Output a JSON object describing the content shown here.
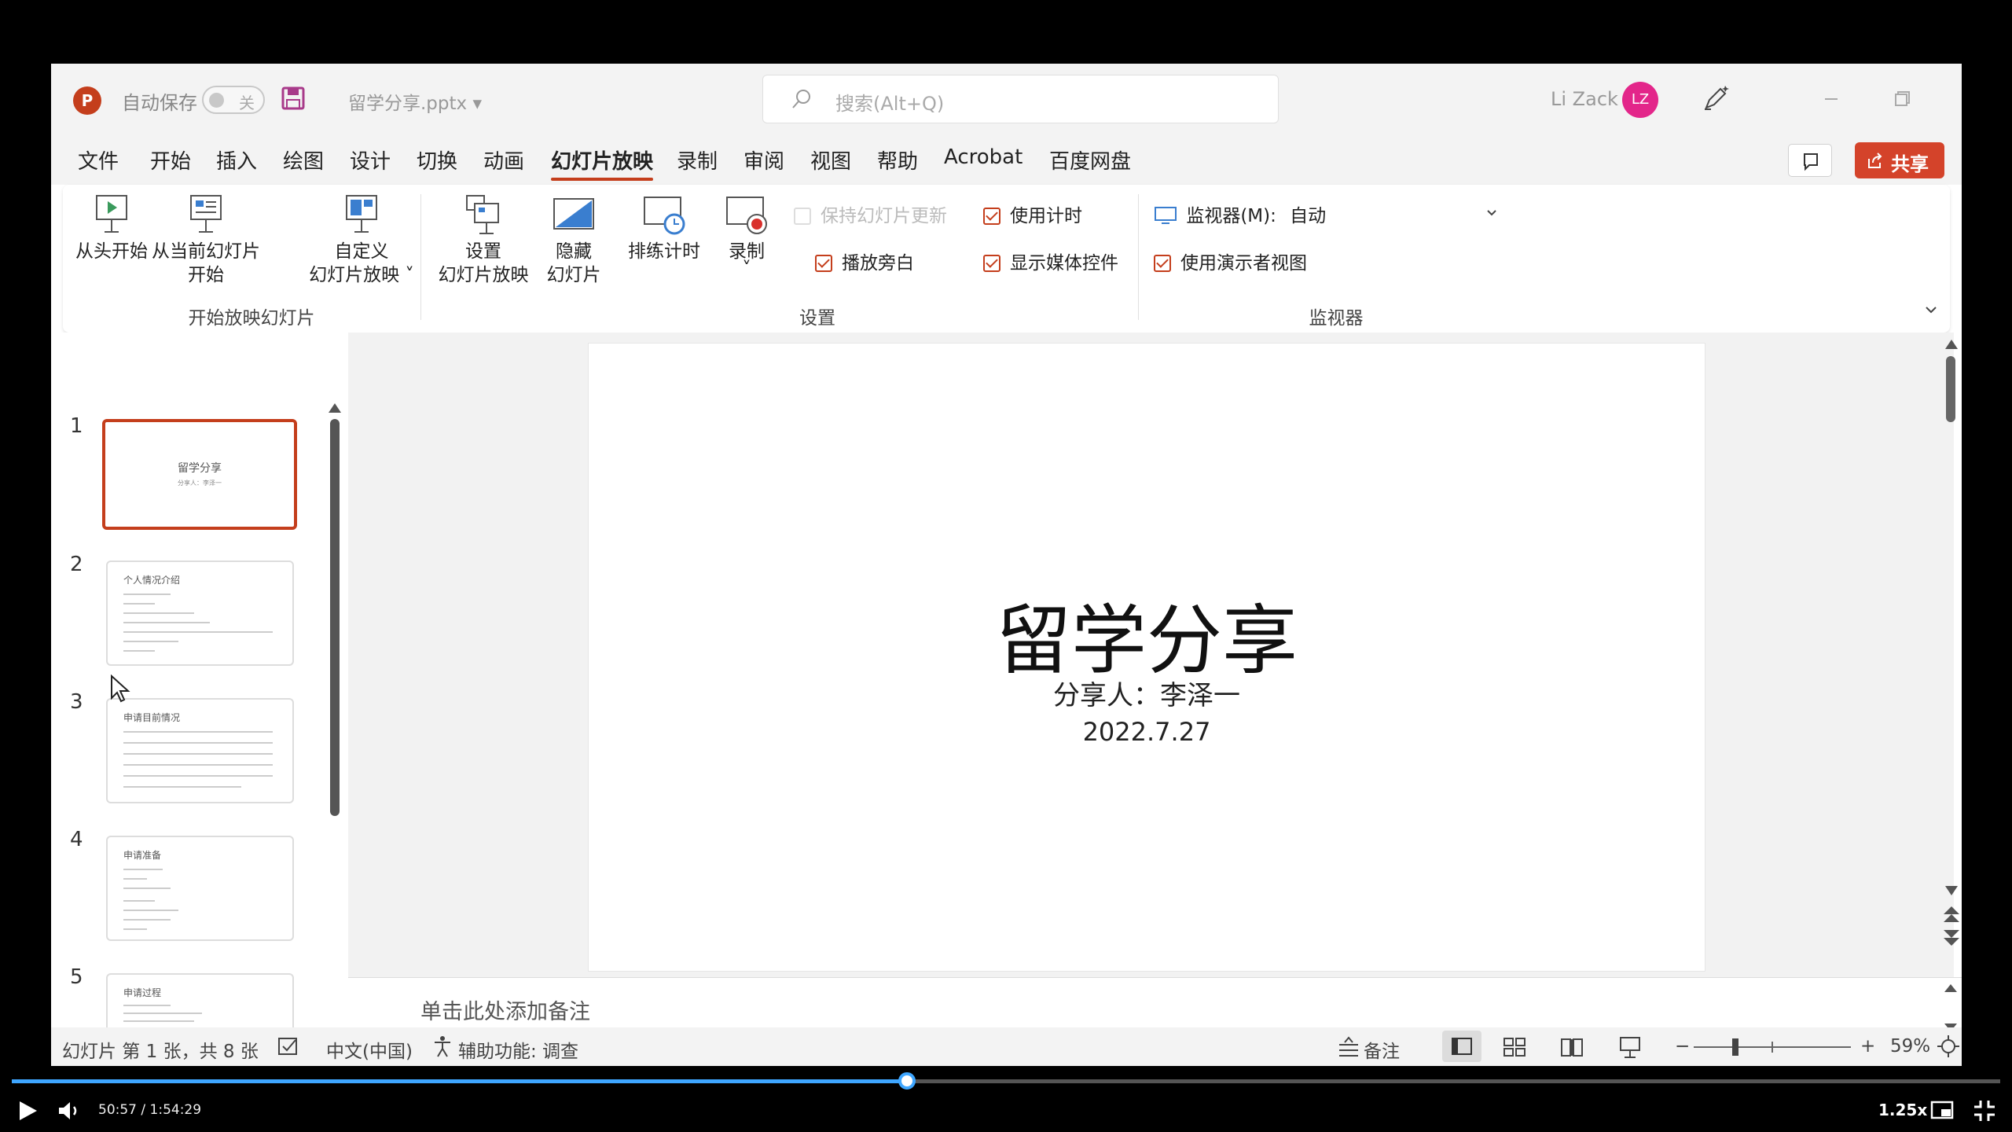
{
  "titlebar": {
    "app_icon": "powerpoint-logo",
    "app_letter": "P",
    "autosave_label": "自动保存",
    "autosave_state": "关",
    "doc_name": "留学分享.pptx",
    "search_placeholder": "搜索(Alt+Q)",
    "user_name": "Li Zack",
    "avatar_initials": "LZ",
    "avatar_color": "#e3268a"
  },
  "menu": {
    "tabs": [
      "文件",
      "开始",
      "插入",
      "绘图",
      "设计",
      "切换",
      "动画",
      "幻灯片放映",
      "录制",
      "审阅",
      "视图",
      "帮助",
      "Acrobat",
      "百度网盘"
    ],
    "active_tab": "幻灯片放映",
    "share_label": "共享",
    "accent": "#c43e1c"
  },
  "ribbon": {
    "from_start": "从头开始",
    "from_current_1": "从当前幻灯片",
    "from_current_2": "开始",
    "custom_1": "自定义",
    "custom_2": "幻灯片放映 ˅",
    "group_start": "开始放映幻灯片",
    "setup_1": "设置",
    "setup_2": "幻灯片放映",
    "hide_1": "隐藏",
    "hide_2": "幻灯片",
    "rehearse": "排练计时",
    "record": "录制",
    "record_caret": "˅",
    "keep_updated": "保持幻灯片更新",
    "use_timings": "使用计时",
    "play_narrations": "播放旁白",
    "show_media": "显示媒体控件",
    "group_setup": "设置",
    "monitor_label": "监视器(M):",
    "monitor_value": "自动",
    "presenter_view": "使用演示者视图",
    "group_monitor": "监视器"
  },
  "thumbnails": {
    "numbers": [
      "1",
      "2",
      "3",
      "4",
      "5"
    ],
    "slide1_title": "留学分享",
    "slide1_sub": "分享人：李泽一",
    "slide2_title": "个人情况介绍",
    "slide3_title": "申请目前情况",
    "slide4_title": "申请准备",
    "slide5_title": "申请过程"
  },
  "slide": {
    "title": "留学分享",
    "presenter": "分享人：李泽一",
    "date": "2022.7.27"
  },
  "notes": {
    "placeholder": "单击此处添加备注"
  },
  "statusbar": {
    "slide_info": "幻灯片 第 1 张，共 8 张",
    "language": "中文(中国)",
    "accessibility": "辅助功能: 调查",
    "notes_label": "备注",
    "zoom": "59%",
    "zoom_minus": "−",
    "zoom_plus": "+"
  },
  "player": {
    "time": "50:57 / 1:54:29",
    "speed": "1.25x",
    "progress": 0.45
  }
}
